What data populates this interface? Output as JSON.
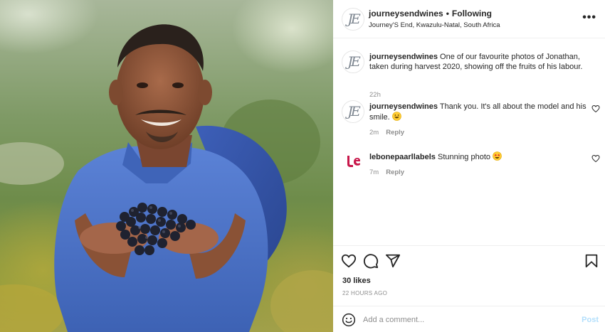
{
  "post": {
    "username": "journeysendwines",
    "follow_status": "Following",
    "separator": "•",
    "location": "Journey'S End, Kwazulu-Natal, South Africa",
    "more_icon": "more-horizontal-icon",
    "photo_description_icon": "post-photo"
  },
  "comments": [
    {
      "username": "journeysendwines",
      "text": "One of our favourite photos of Jonathan, taken during harvest 2020, showing off the fruits of his labour.",
      "time": "22h",
      "reply_label": ""
    },
    {
      "username": "journeysendwines",
      "text": "Thank you. It's all about the model and his smile.",
      "emoji": "grinning-face",
      "time": "2m",
      "reply_label": "Reply"
    },
    {
      "username": "lebonepaarllabels",
      "text": "Stunning photo",
      "emoji": "star-struck-face",
      "time": "7m",
      "reply_label": "Reply"
    }
  ],
  "actions": {
    "like_icon": "heart-icon",
    "comment_icon": "comment-icon",
    "share_icon": "share-icon",
    "save_icon": "bookmark-icon",
    "likes_text": "30 likes",
    "timestamp": "22 HOURS AGO"
  },
  "add_comment": {
    "placeholder": "Add a comment...",
    "post_label": "Post"
  },
  "colors": {
    "text": "#262626",
    "secondary": "#8e8e8e",
    "post_disabled": "#b2dffc",
    "shirt": "#4a72c8",
    "lebone_logo": "#c8174a"
  }
}
